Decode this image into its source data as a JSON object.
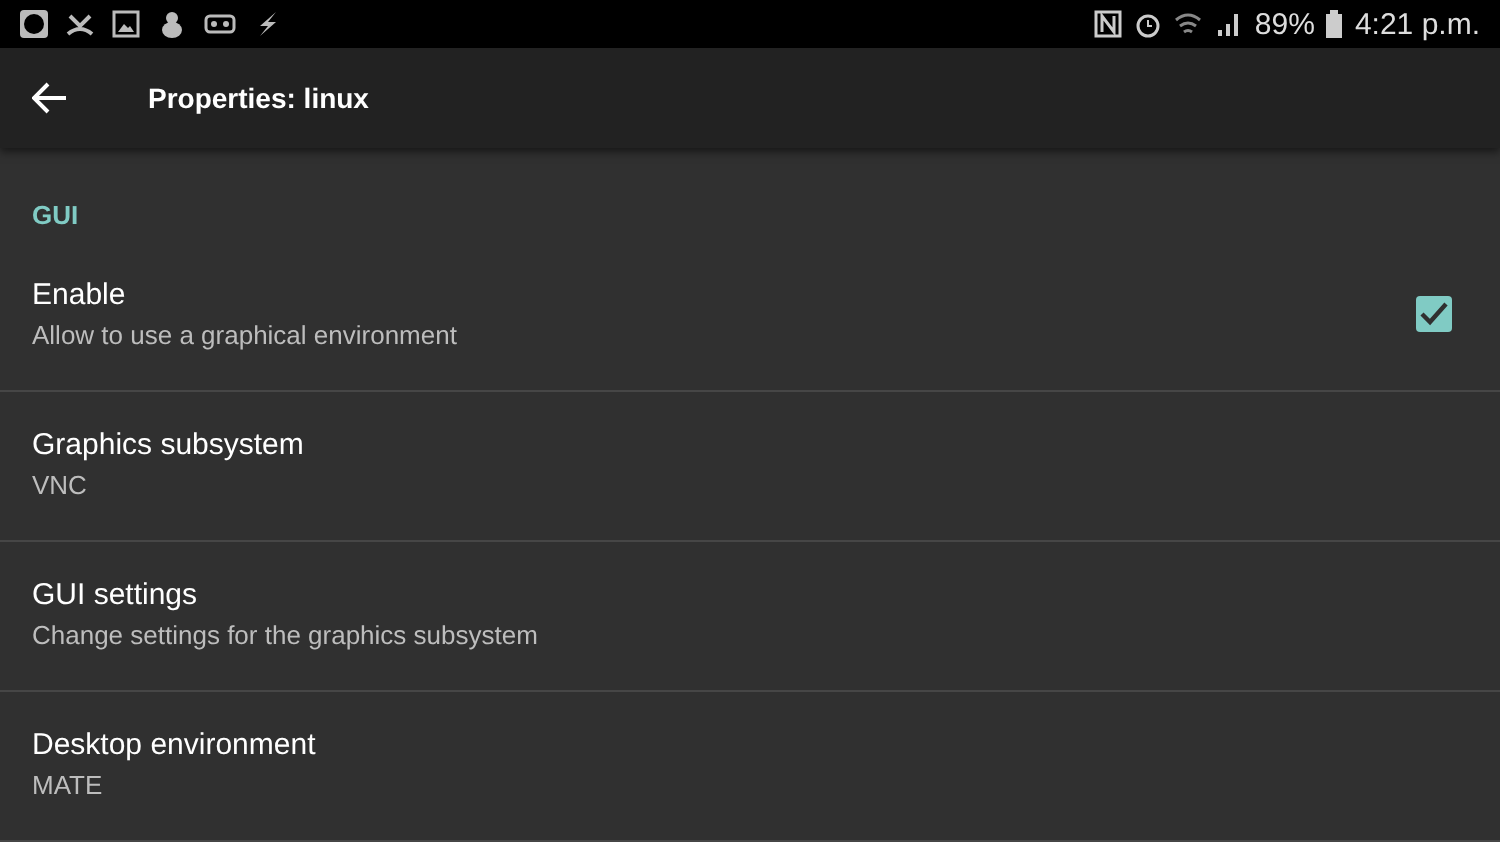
{
  "status_bar": {
    "battery": "89%",
    "time": "4:21 p.m."
  },
  "app_bar": {
    "title": "Properties: linux"
  },
  "section": {
    "title": "GUI"
  },
  "preferences": [
    {
      "kind": "checkbox",
      "title": "Enable",
      "summary": "Allow to use a graphical environment",
      "checked": true
    },
    {
      "kind": "plain",
      "title": "Graphics subsystem",
      "summary": "VNC"
    },
    {
      "kind": "plain",
      "title": "GUI settings",
      "summary": "Change settings for the graphics subsystem"
    },
    {
      "kind": "plain",
      "title": "Desktop environment",
      "summary": "MATE"
    }
  ]
}
